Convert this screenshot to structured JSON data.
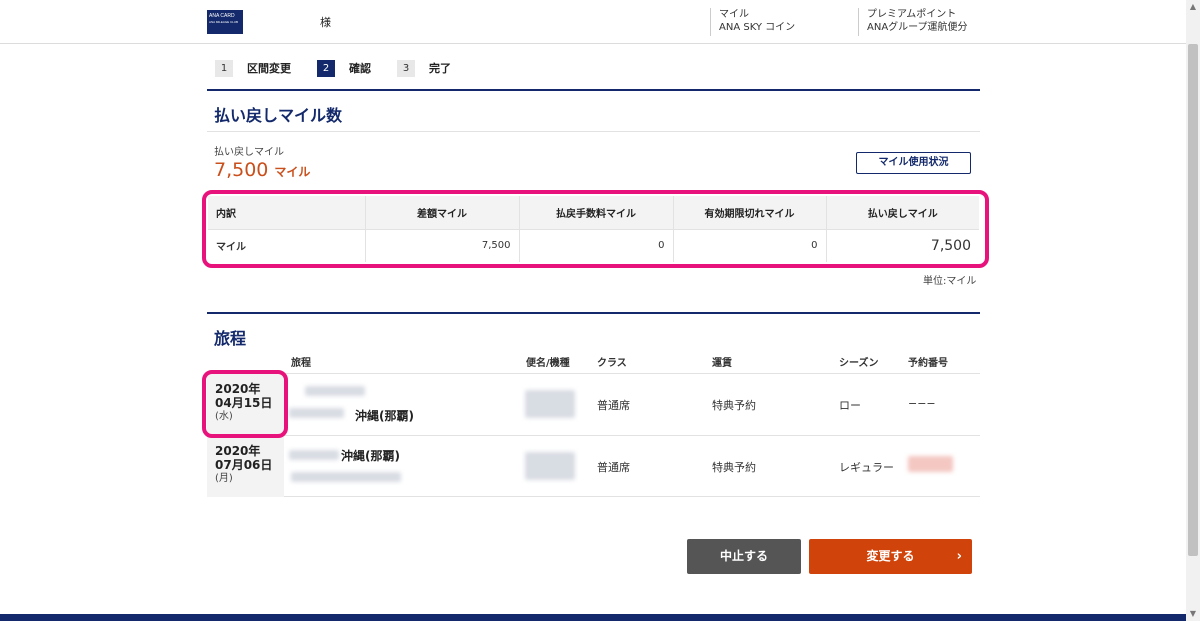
{
  "header": {
    "logo_text": "ANA CARD",
    "logo_sub": "ANA MILEAGE CLUB",
    "sama": "様",
    "miles_label": "マイル",
    "coin_label": "ANA SKY コイン",
    "premium_label": "プレミアムポイント",
    "group_label": "ANAグループ運航便分"
  },
  "steps": [
    {
      "num": "1",
      "label": "区間変更"
    },
    {
      "num": "2",
      "label": "確認"
    },
    {
      "num": "3",
      "label": "完了"
    }
  ],
  "refund": {
    "section_title": "払い戻しマイル数",
    "label": "払い戻しマイル",
    "value": "7,500",
    "unit": "マイル",
    "usage_button": "マイル使用状況"
  },
  "breakdown": {
    "headers": [
      "内訳",
      "差額マイル",
      "払戻手数料マイル",
      "有効期限切れマイル",
      "払い戻しマイル"
    ],
    "row": [
      "マイル",
      "7,500",
      "0",
      "0",
      "7,500"
    ],
    "unit_note": "単位:マイル"
  },
  "itinerary": {
    "section_title": "旅程",
    "headers": [
      "旅程",
      "便名/機種",
      "クラス",
      "運賃",
      "シーズン",
      "予約番号"
    ],
    "rows": [
      {
        "year": "2020年",
        "date": "04月15日",
        "dow": "(水)",
        "destination": "沖縄(那覇)",
        "class": "普通席",
        "fare": "特典予約",
        "season": "ロー",
        "reservation": "−−−"
      },
      {
        "year": "2020年",
        "date": "07月06日",
        "dow": "(月)",
        "destination": "沖縄(那覇)",
        "class": "普通席",
        "fare": "特典予約",
        "season": "レギュラー",
        "reservation": ""
      }
    ]
  },
  "buttons": {
    "cancel": "中止する",
    "change": "変更する"
  },
  "colors": {
    "brand_navy": "#13296b",
    "accent_orange": "#d0440c",
    "highlight_pink": "#e8127c"
  }
}
